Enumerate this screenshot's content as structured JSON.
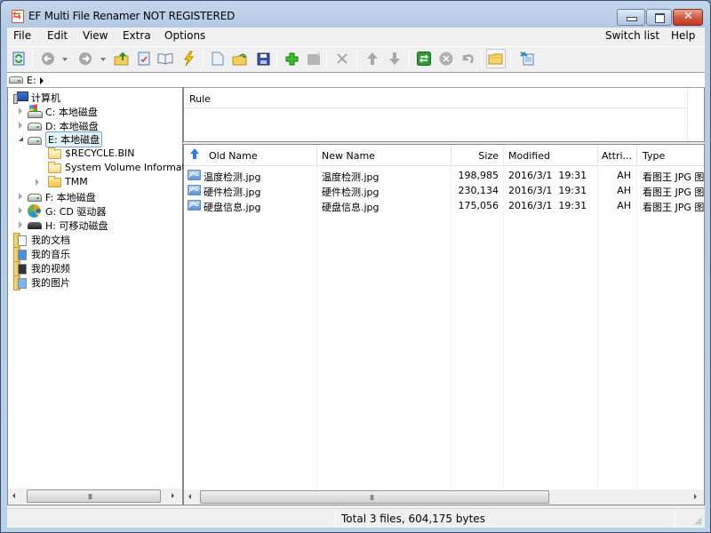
{
  "window": {
    "title": "EF Multi File Renamer NOT REGISTERED"
  },
  "menu": {
    "left": [
      "File",
      "Edit",
      "View",
      "Extra",
      "Options"
    ],
    "right": [
      "Switch list",
      "Help"
    ]
  },
  "toolbar": {
    "buttons": [
      {
        "icon": "refresh-icon",
        "enabled": true
      },
      {
        "icon": "back-icon",
        "enabled": false,
        "dropdown": true
      },
      {
        "icon": "forward-icon",
        "enabled": false,
        "dropdown": true
      },
      {
        "icon": "folder-up-icon",
        "enabled": true
      },
      {
        "icon": "check-document-icon",
        "enabled": true
      },
      {
        "icon": "book-icon",
        "enabled": true
      },
      {
        "icon": "lightning-icon",
        "enabled": true
      },
      {
        "icon": "new-document-icon",
        "enabled": true
      },
      {
        "icon": "open-folder-icon",
        "enabled": true
      },
      {
        "icon": "save-icon",
        "enabled": true
      },
      {
        "icon": "add-rule-icon",
        "enabled": true
      },
      {
        "icon": "edit-rule-icon",
        "enabled": false
      },
      {
        "icon": "delete-icon",
        "enabled": false
      },
      {
        "icon": "move-up-icon",
        "enabled": false
      },
      {
        "icon": "move-down-icon",
        "enabled": false
      },
      {
        "icon": "rename-icon",
        "enabled": true
      },
      {
        "icon": "cancel-icon",
        "enabled": false
      },
      {
        "icon": "undo-icon",
        "enabled": false
      },
      {
        "icon": "folder-icon",
        "enabled": true,
        "pressed": true
      },
      {
        "icon": "export-list-icon",
        "enabled": true
      }
    ]
  },
  "address": {
    "path": "E:"
  },
  "tree": {
    "items": [
      {
        "label": "计算机",
        "level": 0,
        "icon": "computer-icon",
        "expander": "none"
      },
      {
        "label": "C: 本地磁盘",
        "level": 1,
        "icon": "system-drive-icon",
        "expander": "collapsed"
      },
      {
        "label": "D: 本地磁盘",
        "level": 1,
        "icon": "drive-icon",
        "expander": "collapsed"
      },
      {
        "label": "E: 本地磁盘",
        "level": 1,
        "icon": "drive-icon",
        "expander": "expanded",
        "selected": true
      },
      {
        "label": "$RECYCLE.BIN",
        "level": 2,
        "icon": "folder-icon",
        "expander": "none"
      },
      {
        "label": "System Volume Information",
        "level": 2,
        "icon": "folder-icon",
        "expander": "none"
      },
      {
        "label": "TMM",
        "level": 2,
        "icon": "folder-full-icon",
        "expander": "collapsed"
      },
      {
        "label": "F: 本地磁盘",
        "level": 1,
        "icon": "drive-icon",
        "expander": "collapsed"
      },
      {
        "label": "G: CD 驱动器",
        "level": 1,
        "icon": "cd-drive-icon",
        "expander": "collapsed"
      },
      {
        "label": "H: 可移动磁盘",
        "level": 1,
        "icon": "removable-drive-icon",
        "expander": "collapsed"
      },
      {
        "label": "我的文档",
        "level": 0,
        "icon": "documents-library-icon",
        "expander": "none"
      },
      {
        "label": "我的音乐",
        "level": 0,
        "icon": "music-library-icon",
        "expander": "none"
      },
      {
        "label": "我的视频",
        "level": 0,
        "icon": "video-library-icon",
        "expander": "none"
      },
      {
        "label": "我的图片",
        "level": 0,
        "icon": "pictures-library-icon",
        "expander": "none"
      }
    ]
  },
  "rules": {
    "header": "Rule",
    "items": []
  },
  "files": {
    "columns": [
      "Old Name",
      "New Name",
      "Size",
      "Modified",
      "Attri...",
      "Type"
    ],
    "sort": {
      "column": "Old Name",
      "direction": "ascending"
    },
    "rows": [
      {
        "old_name": "温度检测.jpg",
        "new_name": "温度检测.jpg",
        "size": "198,985",
        "modified": "2016/3/1  19:31",
        "attributes": "AH",
        "type": "看图王 JPG 图"
      },
      {
        "old_name": "硬件检测.jpg",
        "new_name": "硬件检测.jpg",
        "size": "230,134",
        "modified": "2016/3/1  19:31",
        "attributes": "AH",
        "type": "看图王 JPG 图"
      },
      {
        "old_name": "硬盘信息.jpg",
        "new_name": "硬盘信息.jpg",
        "size": "175,056",
        "modified": "2016/3/1  19:31",
        "attributes": "AH",
        "type": "看图王 JPG 图"
      }
    ]
  },
  "scrollbars": {
    "grip": "III"
  },
  "status": {
    "text": "Total 3 files, 604,175 bytes"
  }
}
